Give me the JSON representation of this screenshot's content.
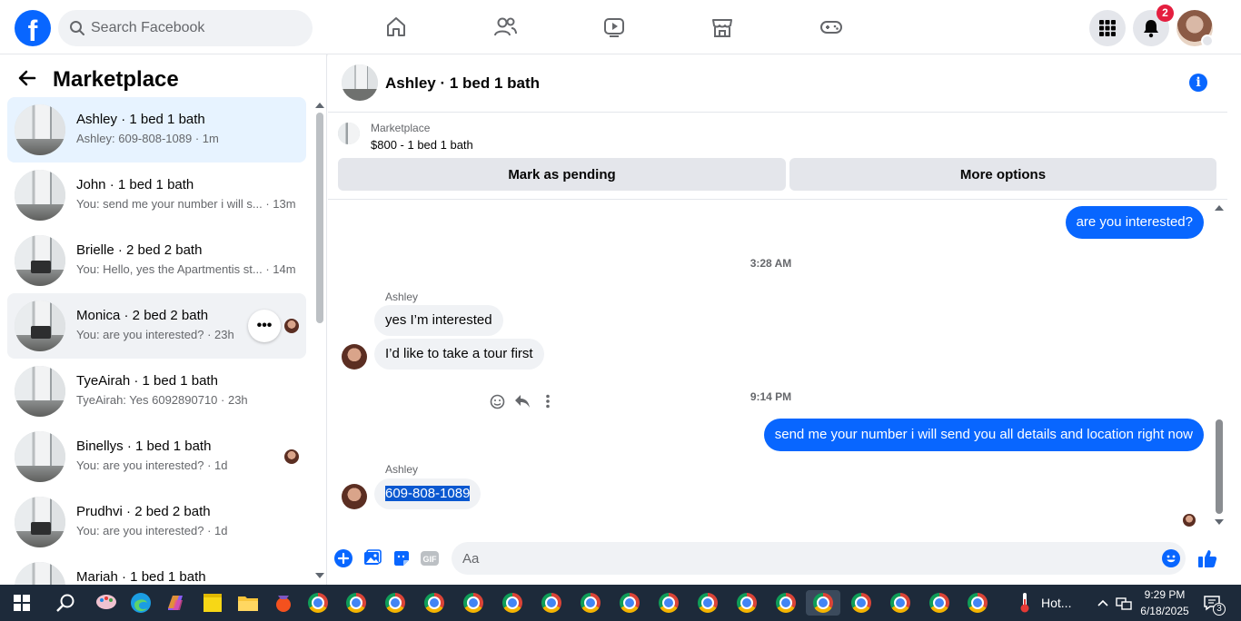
{
  "topbar": {
    "logo": "f",
    "search_placeholder": "Search Facebook",
    "notifications_count": "2",
    "icons": [
      "home-icon",
      "friends-icon",
      "video-icon",
      "marketplace-icon",
      "gaming-icon",
      "menu-grid-icon",
      "bell-icon"
    ]
  },
  "sidebar": {
    "title": "Marketplace",
    "conversations": [
      {
        "name": "Ashley · 1 bed 1 bath",
        "preview": "Ashley: 609-808-1089 · 1m"
      },
      {
        "name": "John · 1 bed 1 bath",
        "preview": "You: send me your number i will s... · 13m"
      },
      {
        "name": "Brielle · 2 bed 2 bath",
        "preview": "You: Hello, yes the Apartmentis st... · 14m"
      },
      {
        "name": "Monica · 2 bed 2 bath",
        "preview": "You: are you interested? · 23h"
      },
      {
        "name": "TyeAirah · 1 bed 1 bath",
        "preview": "TyeAirah: Yes 6092890710 · 23h"
      },
      {
        "name": "Binellys · 1 bed 1 bath",
        "preview": "You: are you interested? · 1d"
      },
      {
        "name": "Prudhvi · 2 bed 2 bath",
        "preview": "You: are you interested? · 1d"
      },
      {
        "name": "Mariah · 1 bed 1 bath",
        "preview": ""
      }
    ],
    "more_label": "•••"
  },
  "chat": {
    "title": "Ashley · 1 bed 1 bath",
    "info_icon": "i",
    "listing_category": "Marketplace",
    "listing_price": "$800 - 1 bed 1 bath",
    "mark_pending": "Mark as pending",
    "more_options": "More options",
    "messages": {
      "out1": "are you interested?",
      "ts1": "3:28 AM",
      "sender1": "Ashley",
      "in1": "yes I’m interested",
      "in2": "I’d like to take a tour first",
      "ts2": "9:14 PM",
      "out2": "send me your number i will send you all details and location right now",
      "sender2": "Ashley",
      "in3": "609-808-1089"
    },
    "composer_placeholder": "Aa",
    "gif_label": "GIF"
  },
  "taskbar": {
    "weather_text": "Hot...",
    "time": "9:29 PM",
    "date": "6/18/2025",
    "notif_count": "3",
    "colors": {
      "bg": "#1d2a3a",
      "accent": "#0866ff"
    }
  }
}
